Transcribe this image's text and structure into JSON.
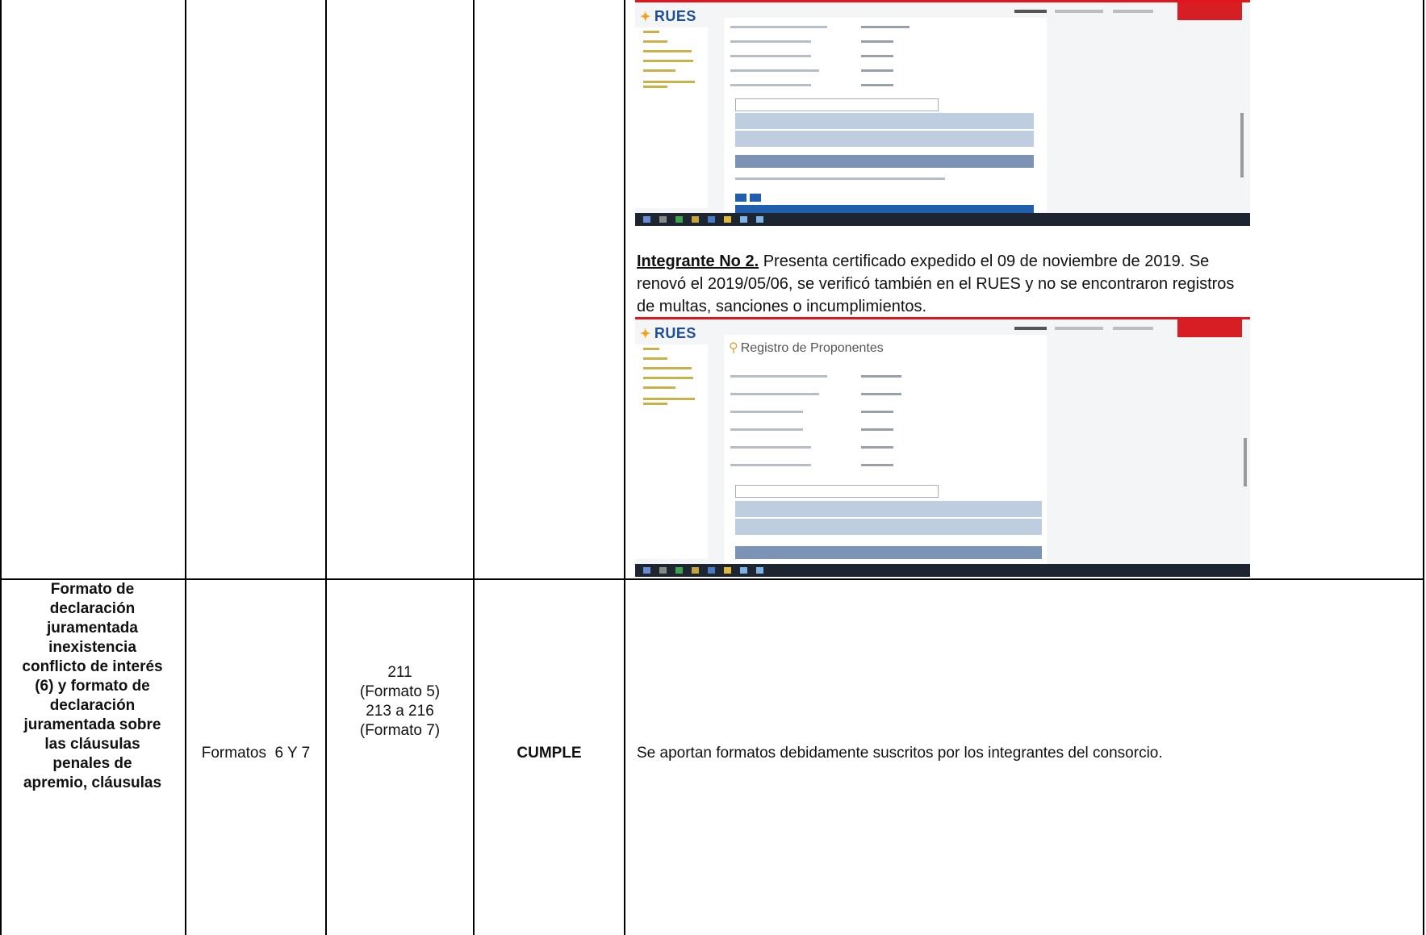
{
  "paragraph": {
    "bold_label": "Integrante No 2.",
    "text": " Presenta certificado expedido el 09 de noviembre de 2019. Se renovó el 2019/05/06, se verificó también en el RUES y no se encontraron registros de multas, sanciones o incumplimientos."
  },
  "screenshot1": {
    "logo": "RUES"
  },
  "screenshot2": {
    "logo": "RUES",
    "title": "Registro de Proponentes"
  },
  "row": {
    "requirement": [
      "Formato de",
      "declaración",
      "juramentada",
      "inexistencia",
      "conflicto de interés",
      "(6) y formato de",
      "declaración",
      "juramentada sobre",
      "las cláusulas",
      "penales de",
      "apremio, cláusulas"
    ],
    "document": "Formatos  6 Y 7",
    "folios": [
      "211",
      "(Formato 5)",
      "213 a 216",
      "(Formato 7)"
    ],
    "status": "CUMPLE",
    "observation": "Se aportan formatos debidamente suscritos por los integrantes del consorcio."
  }
}
